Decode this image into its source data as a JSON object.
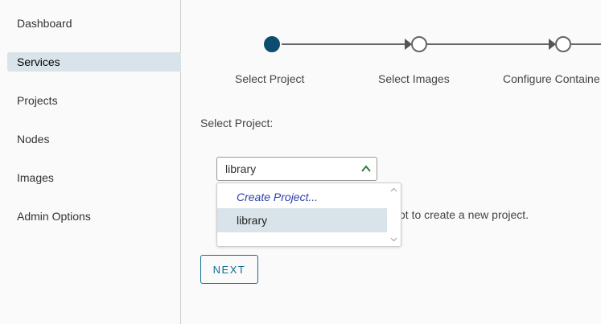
{
  "sidebar": {
    "items": [
      {
        "label": "Dashboard",
        "active": false
      },
      {
        "label": "Services",
        "active": true
      },
      {
        "label": "Projects",
        "active": false
      },
      {
        "label": "Nodes",
        "active": false
      },
      {
        "label": "Images",
        "active": false
      },
      {
        "label": "Admin Options",
        "active": false
      }
    ]
  },
  "wizard": {
    "steps": [
      {
        "label": "Select Project",
        "state": "current"
      },
      {
        "label": "Select Images",
        "state": "pending"
      },
      {
        "label": "Configure Containe",
        "state": "pending"
      }
    ]
  },
  "form": {
    "project_label": "Select Project:",
    "project_select": {
      "value": "library",
      "options": [
        "Create Project...",
        "library"
      ],
      "highlighted": "library"
    },
    "help_text": "ot to create a new project.",
    "next_label": "NEXT"
  },
  "colors": {
    "accent": "#0e4d6e",
    "button": "#0e6e8f",
    "active_nav": "#d9e4ea",
    "chevron": "#2e7d32",
    "create_link": "#2b3fa8"
  }
}
